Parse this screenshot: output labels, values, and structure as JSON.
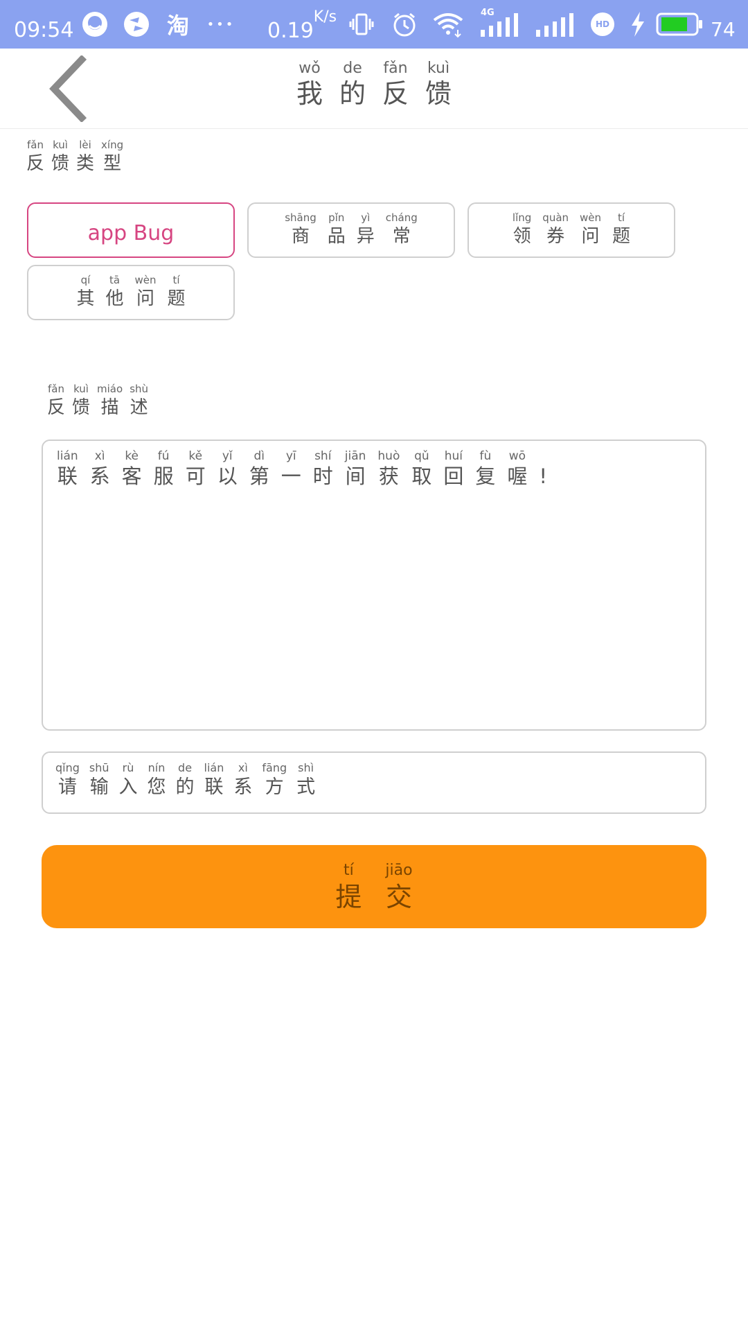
{
  "status_bar": {
    "time": "09:54",
    "speed": "0.19",
    "speed_unit": "K/s",
    "taobao_glyph": "淘",
    "more_glyph": "•••",
    "network_label": "4G",
    "hd_label": "HD",
    "battery_level": "74",
    "colors": {
      "bg": "#8aa2f0",
      "battery": "#22cc22"
    }
  },
  "header": {
    "back_icon": "chevron-left-icon",
    "title": [
      {
        "py": "wǒ",
        "hz": "我"
      },
      {
        "py": "de",
        "hz": "的"
      },
      {
        "py": "fǎn",
        "hz": "反"
      },
      {
        "py": "kuì",
        "hz": "馈"
      }
    ]
  },
  "feedback_type": {
    "label": [
      {
        "py": "fǎn",
        "hz": "反"
      },
      {
        "py": "kuì",
        "hz": "馈"
      },
      {
        "py": "lèi",
        "hz": "类"
      },
      {
        "py": "xíng",
        "hz": "型"
      }
    ],
    "options": [
      {
        "text": "app Bug",
        "selected": true
      },
      {
        "chars": [
          {
            "py": "shāng",
            "hz": "商"
          },
          {
            "py": "pǐn",
            "hz": "品"
          },
          {
            "py": "yì",
            "hz": "异"
          },
          {
            "py": "cháng",
            "hz": "常"
          }
        ]
      },
      {
        "chars": [
          {
            "py": "lǐng",
            "hz": "领"
          },
          {
            "py": "quàn",
            "hz": "券"
          },
          {
            "py": "wèn",
            "hz": "问"
          },
          {
            "py": "tí",
            "hz": "题"
          }
        ]
      },
      {
        "chars": [
          {
            "py": "qí",
            "hz": "其"
          },
          {
            "py": "tā",
            "hz": "他"
          },
          {
            "py": "wèn",
            "hz": "问"
          },
          {
            "py": "tí",
            "hz": "题"
          }
        ]
      }
    ],
    "colors": {
      "selected_border": "#d64581",
      "selected_text": "#d64581",
      "border": "#cfcfcf"
    }
  },
  "feedback_description": {
    "label": [
      {
        "py": "fǎn",
        "hz": "反"
      },
      {
        "py": "kuì",
        "hz": "馈"
      },
      {
        "py": "miáo",
        "hz": "描"
      },
      {
        "py": "shù",
        "hz": "述"
      }
    ],
    "placeholder": [
      {
        "py": "lián",
        "hz": "联"
      },
      {
        "py": "xì",
        "hz": "系"
      },
      {
        "py": "kè",
        "hz": "客"
      },
      {
        "py": "fú",
        "hz": "服"
      },
      {
        "py": "kě",
        "hz": "可"
      },
      {
        "py": "yǐ",
        "hz": "以"
      },
      {
        "py": "dì",
        "hz": "第"
      },
      {
        "py": "yī",
        "hz": "一"
      },
      {
        "py": "shí",
        "hz": "时"
      },
      {
        "py": "jiān",
        "hz": "间"
      },
      {
        "py": "huò",
        "hz": "获"
      },
      {
        "py": "qǔ",
        "hz": "取"
      },
      {
        "py": "huí",
        "hz": "回"
      },
      {
        "py": "fù",
        "hz": "复"
      },
      {
        "py": "wō",
        "hz": "喔"
      },
      {
        "py": "",
        "hz": "!"
      }
    ]
  },
  "contact": {
    "placeholder": [
      {
        "py": "qǐng",
        "hz": "请"
      },
      {
        "py": "shū",
        "hz": "输"
      },
      {
        "py": "rù",
        "hz": "入"
      },
      {
        "py": "nín",
        "hz": "您"
      },
      {
        "py": "de",
        "hz": "的"
      },
      {
        "py": "lián",
        "hz": "联"
      },
      {
        "py": "xì",
        "hz": "系"
      },
      {
        "py": "fāng",
        "hz": "方"
      },
      {
        "py": "shì",
        "hz": "式"
      }
    ]
  },
  "submit": {
    "label": [
      {
        "py": "tí",
        "hz": "提"
      },
      {
        "py": "jiāo",
        "hz": "交"
      }
    ],
    "colors": {
      "bg": "#fd930f",
      "text": "#7a4400"
    }
  }
}
